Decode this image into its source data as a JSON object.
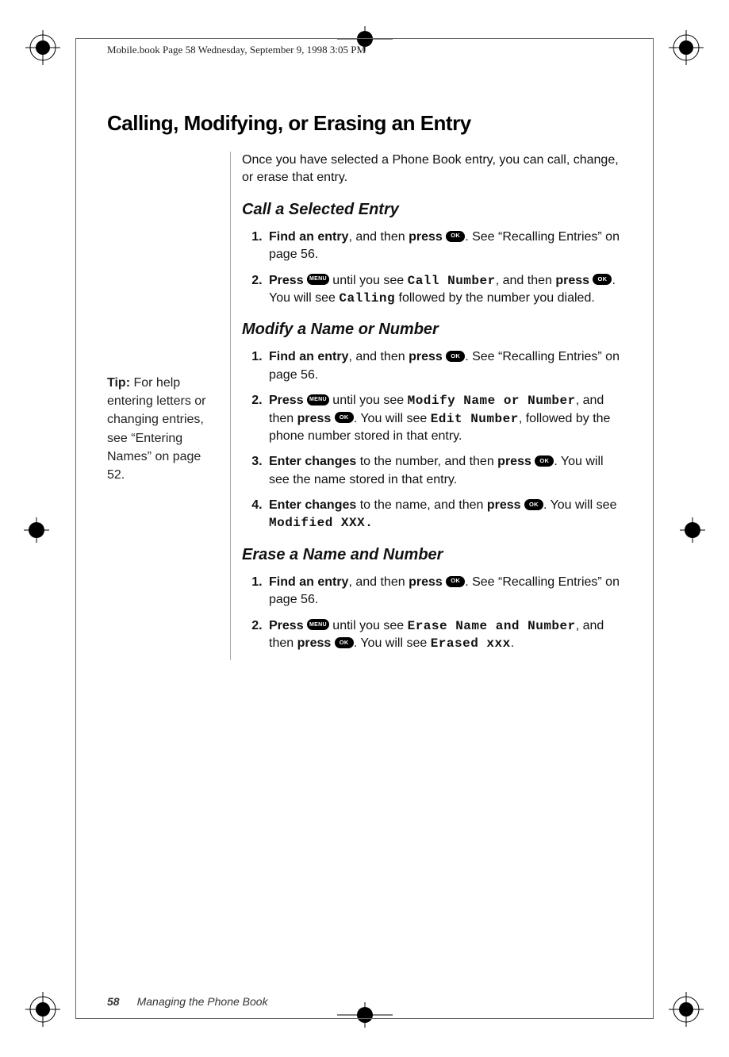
{
  "header": "Mobile.book  Page 58  Wednesday, September 9, 1998  3:05 PM",
  "title": "Calling, Modifying, or Erasing an Entry",
  "intro": "Once you have selected a Phone Book entry, you can call, change, or erase that entry.",
  "tip_label": "Tip:",
  "tip_body": " For help entering letters or changing entries, see “Entering Names” on page 52.",
  "btn_ok": "OK",
  "btn_menu": "MENU",
  "sec_call": {
    "heading": "Call a Selected Entry",
    "s1a": "Find an entry",
    "s1b": ", and then ",
    "s1c": "press ",
    "s1d": ". See “Recalling Entries” on page 56.",
    "s2a": "Press ",
    "s2b": " until you see ",
    "s2c": "Call Number",
    "s2d": ", and then ",
    "s2e": "press ",
    "s2f": ". You will see ",
    "s2g": "Calling",
    "s2h": " followed by the number you dialed."
  },
  "sec_modify": {
    "heading": "Modify a Name or Number",
    "s1a": "Find an entry",
    "s1b": ", and then ",
    "s1c": "press ",
    "s1d": ". See “Recalling Entries” on page 56.",
    "s2a": "Press ",
    "s2b": " until you see ",
    "s2c": "Modify Name or Number",
    "s2d": ", and then ",
    "s2e": "press ",
    "s2f": ". You will see ",
    "s2g": "Edit Number",
    "s2h": ", followed by the phone number stored in that entry.",
    "s3a": "Enter changes",
    "s3b": " to the number, and then ",
    "s3c": "press ",
    "s3d": ". You will see the name stored in that entry.",
    "s4a": "Enter changes",
    "s4b": " to the name, and then ",
    "s4c": "press ",
    "s4d": ". You will see ",
    "s4e": "Modified XXX",
    "s4f": "."
  },
  "sec_erase": {
    "heading": "Erase a Name and Number",
    "s1a": "Find an entry",
    "s1b": ", and then ",
    "s1c": "press ",
    "s1d": ". See “Recalling Entries” on page 56.",
    "s2a": "Press ",
    "s2b": " until you see ",
    "s2c": "Erase Name and Number",
    "s2d": ", and then ",
    "s2e": "press ",
    "s2f": ". You will see ",
    "s2g": "Erased xxx",
    "s2h": "."
  },
  "footer_page": "58",
  "footer_text": "Managing the Phone Book"
}
